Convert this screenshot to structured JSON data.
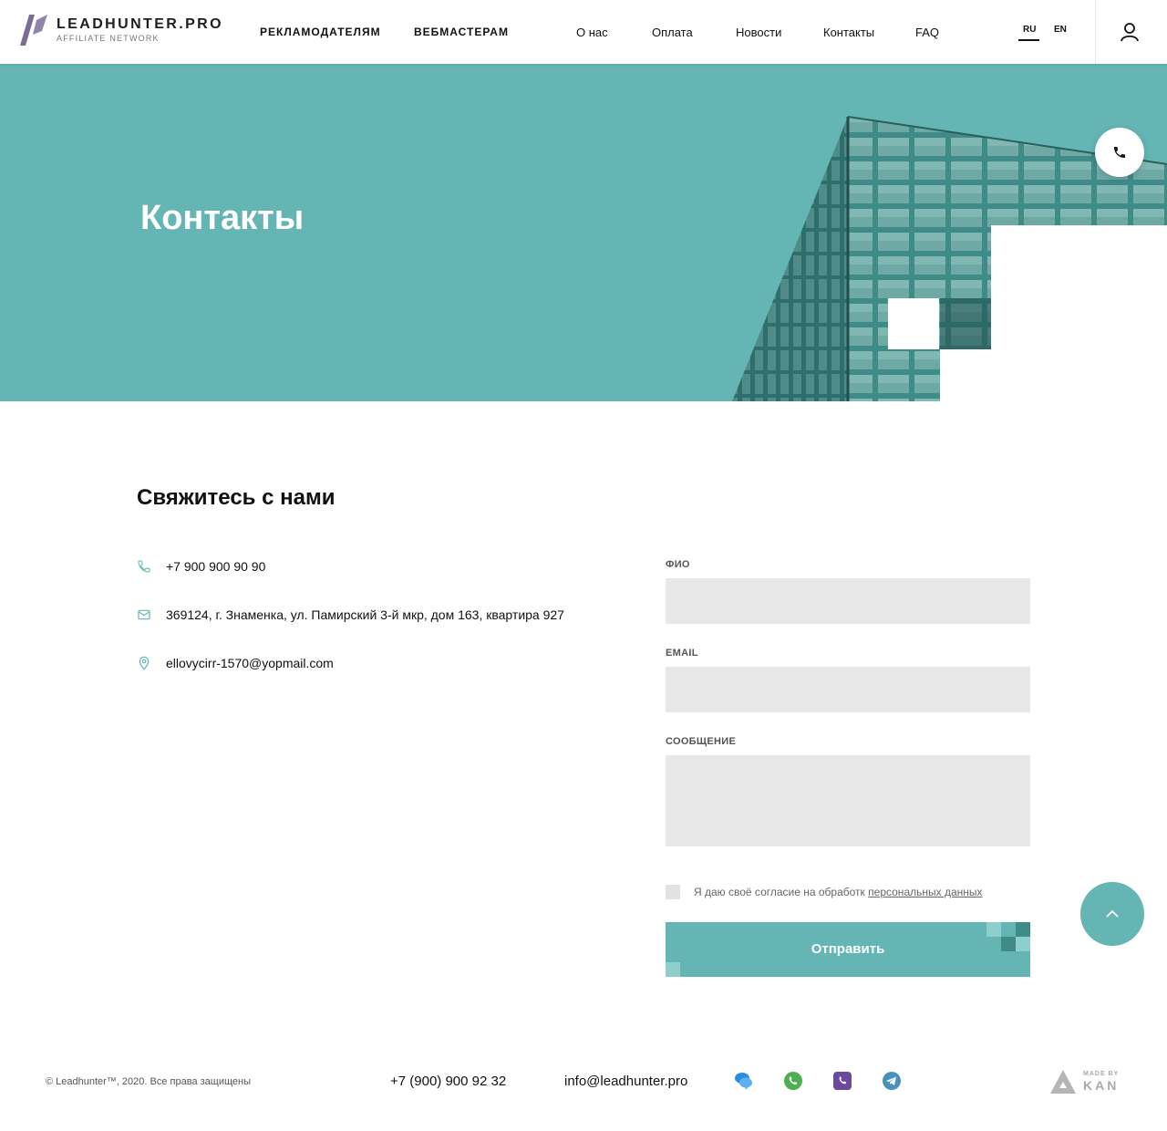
{
  "header": {
    "logo_title": "LEADHUNTER.PRO",
    "logo_subtitle": "AFFILIATE NETWORK",
    "nav_primary": [
      "РЕКЛАМОДАТЕЛЯМ",
      "ВЕБМАСТЕРАМ"
    ],
    "nav_secondary": [
      "О нас",
      "Оплата",
      "Новости",
      "Контакты",
      "FAQ"
    ],
    "languages": [
      "RU",
      "EN"
    ],
    "active_language": "RU"
  },
  "hero": {
    "title": "Контакты"
  },
  "contact": {
    "title": "Свяжитесь с нами",
    "phone": "+7 900 900 90 90",
    "address": "369124, г. Знаменка, ул. Памирский 3-й мкр, дом 163, квартира 927",
    "email": "ellovycirr-1570@yopmail.com"
  },
  "form": {
    "name_label": "ФИО",
    "email_label": "EMAIL",
    "message_label": "СООБЩЕНИЕ",
    "name_value": "",
    "email_value": "",
    "message_value": "",
    "consent_text": "Я даю своё согласие на обработк",
    "consent_link": "персональных данных",
    "consent_checked": false,
    "submit_label": "Отправить"
  },
  "footer": {
    "copyright": "© Leadhunter™, 2020. Все права защищены",
    "phone": "+7 (900) 900 92 32",
    "email": "info@leadhunter.pro",
    "socials": [
      "chat-icon",
      "whatsapp-icon",
      "viber-icon",
      "telegram-icon"
    ],
    "made_by_label": "MADE BY",
    "made_by_name": "KAN"
  },
  "colors": {
    "accent": "#64b5b4",
    "field_bg": "#e7e7e7",
    "text": "#111111"
  }
}
